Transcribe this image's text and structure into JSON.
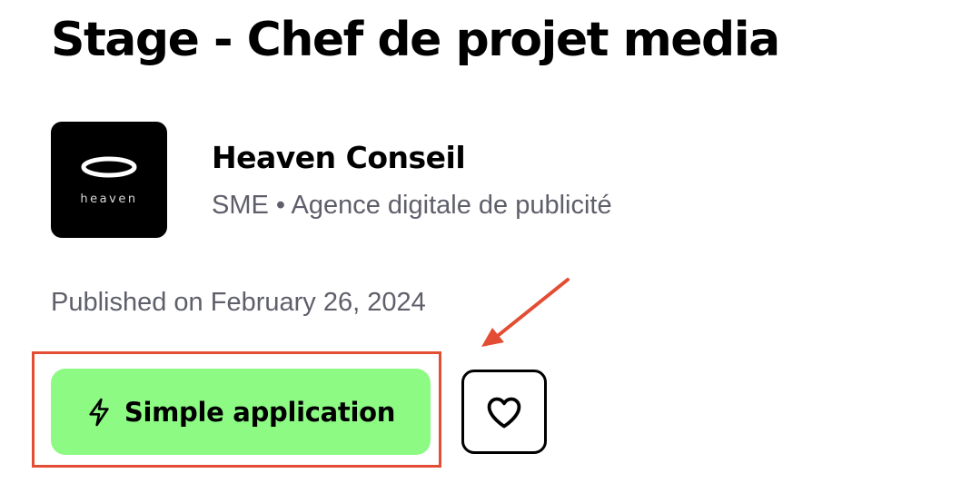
{
  "job": {
    "title": "Stage - Chef de projet media"
  },
  "company": {
    "logo_text": "heaven",
    "name": "Heaven Conseil",
    "meta": "SME • Agence digitale de publicité"
  },
  "published": "Published on February 26, 2024",
  "actions": {
    "apply_label": "Simple application",
    "apply_icon": "lightning-bolt-icon",
    "favorite_icon": "heart-icon"
  },
  "colors": {
    "apply_button": "#8cfa83",
    "annotation": "#e34d33",
    "secondary_text": "#5f5f6b"
  }
}
